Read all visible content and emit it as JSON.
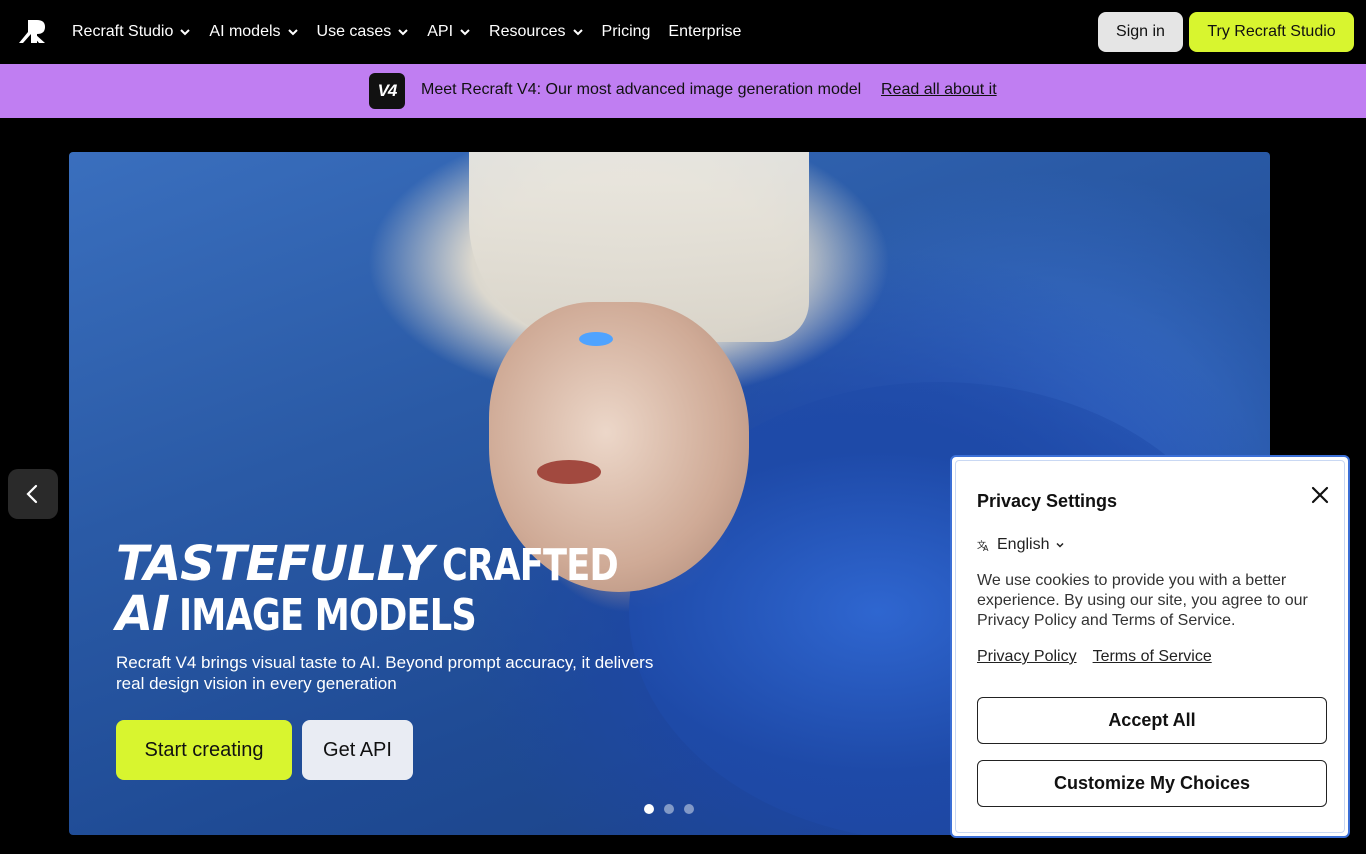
{
  "navbar": {
    "logo_icon": "recraft-logo-icon",
    "items": [
      {
        "label": "Recraft Studio",
        "dropdown": true
      },
      {
        "label": "AI models",
        "dropdown": true
      },
      {
        "label": "Use cases",
        "dropdown": true
      },
      {
        "label": "API",
        "dropdown": true
      },
      {
        "label": "Resources",
        "dropdown": true
      },
      {
        "label": "Pricing",
        "dropdown": false
      },
      {
        "label": "Enterprise",
        "dropdown": false
      }
    ],
    "signin_label": "Sign in",
    "try_label": "Try Recraft Studio",
    "accent_color": "#d8f52f"
  },
  "announcement": {
    "badge": "V4",
    "text": "Meet Recraft V4: Our most advanced image generation model",
    "link": "Read all about it",
    "bg_color": "#c07ef2"
  },
  "hero": {
    "headline_line1_italic": "TASTEFULLY",
    "headline_line1_rest": "CRAFTED",
    "headline_line2_italic": "AI",
    "headline_line2_rest": "IMAGE MODELS",
    "subtitle": "Recraft V4 brings visual taste to AI. Beyond prompt accuracy, it delivers real design vision in every generation",
    "primary_button": "Start creating",
    "secondary_button": "Get API",
    "slides_total": 3,
    "active_slide": 1,
    "prev_icon": "chevron-left-icon"
  },
  "privacy": {
    "title": "Privacy Settings",
    "language": "English",
    "body": "We use cookies to provide you with a better experience. By using our site, you agree to our Privacy Policy and Terms of Service.",
    "privacy_link": "Privacy Policy",
    "terms_link": "Terms of Service",
    "accept_label": "Accept All",
    "customize_label": "Customize My Choices",
    "border_color": "#3b6fd6"
  }
}
